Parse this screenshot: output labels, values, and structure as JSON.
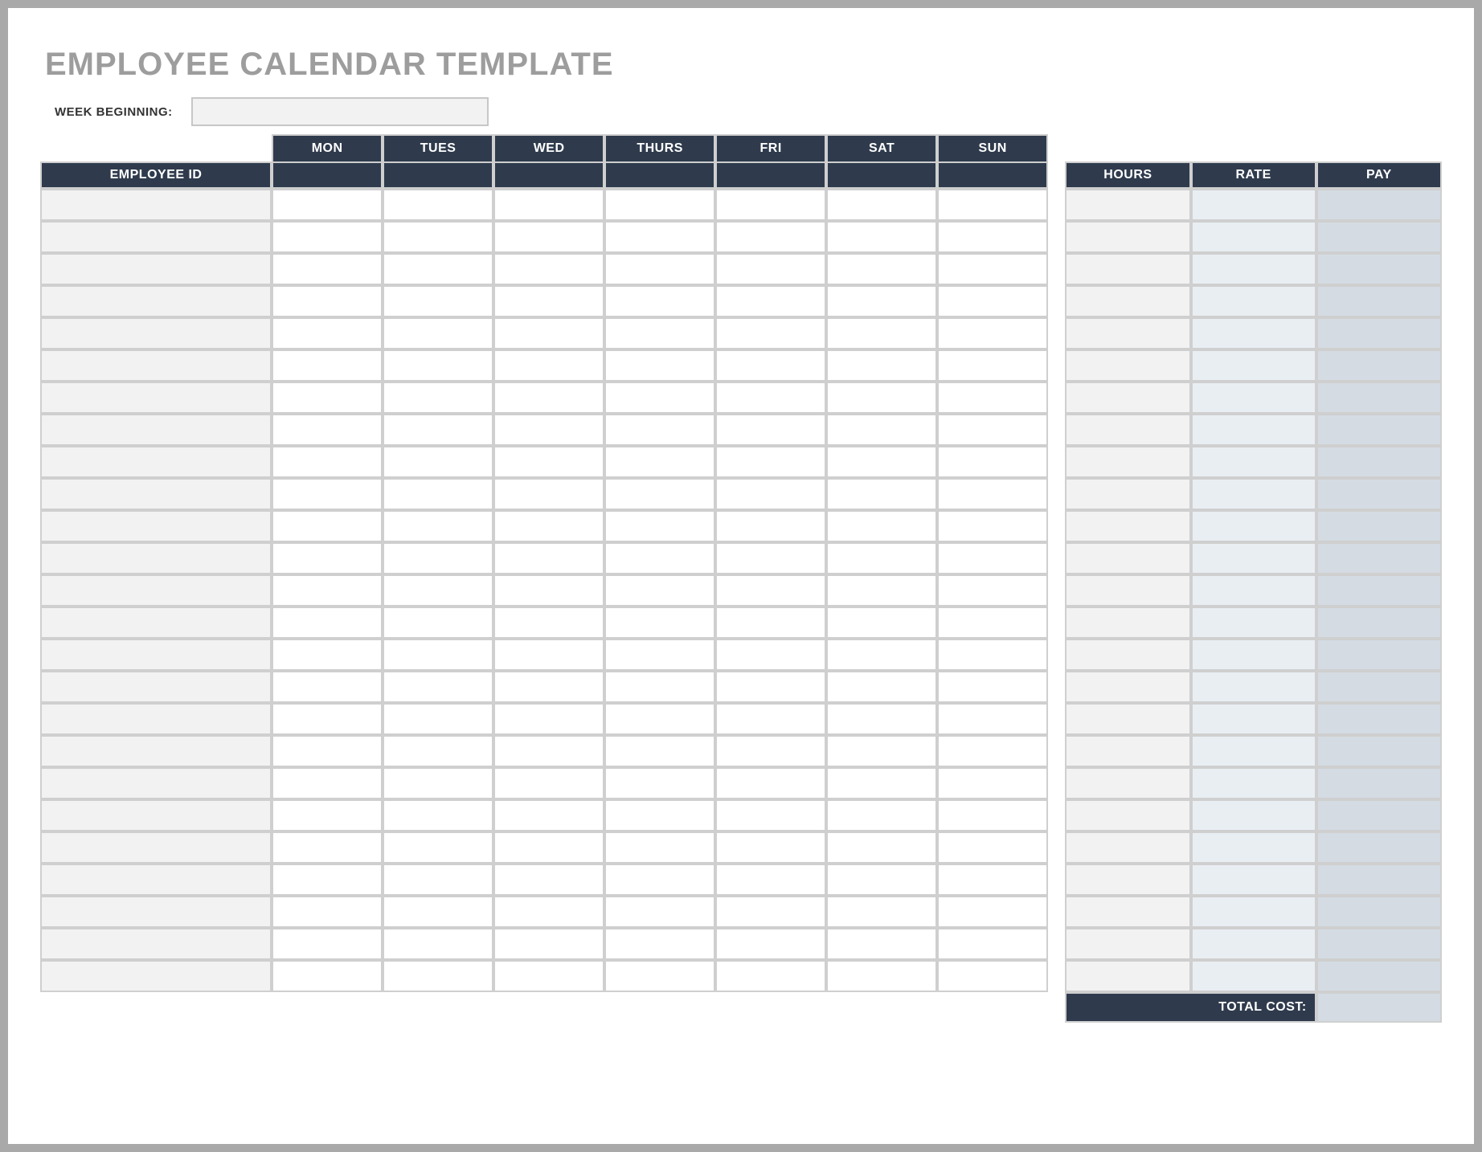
{
  "title": "EMPLOYEE CALENDAR TEMPLATE",
  "week": {
    "label": "WEEK BEGINNING:",
    "value": ""
  },
  "days": [
    "MON",
    "TUES",
    "WED",
    "THURS",
    "FRI",
    "SAT",
    "SUN"
  ],
  "columns": {
    "employee_id": "EMPLOYEE ID",
    "hours": "HOURS",
    "rate": "RATE",
    "pay": "PAY"
  },
  "rows": [
    {
      "employee_id": "",
      "mon": "",
      "tues": "",
      "wed": "",
      "thurs": "",
      "fri": "",
      "sat": "",
      "sun": "",
      "hours": "",
      "rate": "",
      "pay": ""
    },
    {
      "employee_id": "",
      "mon": "",
      "tues": "",
      "wed": "",
      "thurs": "",
      "fri": "",
      "sat": "",
      "sun": "",
      "hours": "",
      "rate": "",
      "pay": ""
    },
    {
      "employee_id": "",
      "mon": "",
      "tues": "",
      "wed": "",
      "thurs": "",
      "fri": "",
      "sat": "",
      "sun": "",
      "hours": "",
      "rate": "",
      "pay": ""
    },
    {
      "employee_id": "",
      "mon": "",
      "tues": "",
      "wed": "",
      "thurs": "",
      "fri": "",
      "sat": "",
      "sun": "",
      "hours": "",
      "rate": "",
      "pay": ""
    },
    {
      "employee_id": "",
      "mon": "",
      "tues": "",
      "wed": "",
      "thurs": "",
      "fri": "",
      "sat": "",
      "sun": "",
      "hours": "",
      "rate": "",
      "pay": ""
    },
    {
      "employee_id": "",
      "mon": "",
      "tues": "",
      "wed": "",
      "thurs": "",
      "fri": "",
      "sat": "",
      "sun": "",
      "hours": "",
      "rate": "",
      "pay": ""
    },
    {
      "employee_id": "",
      "mon": "",
      "tues": "",
      "wed": "",
      "thurs": "",
      "fri": "",
      "sat": "",
      "sun": "",
      "hours": "",
      "rate": "",
      "pay": ""
    },
    {
      "employee_id": "",
      "mon": "",
      "tues": "",
      "wed": "",
      "thurs": "",
      "fri": "",
      "sat": "",
      "sun": "",
      "hours": "",
      "rate": "",
      "pay": ""
    },
    {
      "employee_id": "",
      "mon": "",
      "tues": "",
      "wed": "",
      "thurs": "",
      "fri": "",
      "sat": "",
      "sun": "",
      "hours": "",
      "rate": "",
      "pay": ""
    },
    {
      "employee_id": "",
      "mon": "",
      "tues": "",
      "wed": "",
      "thurs": "",
      "fri": "",
      "sat": "",
      "sun": "",
      "hours": "",
      "rate": "",
      "pay": ""
    },
    {
      "employee_id": "",
      "mon": "",
      "tues": "",
      "wed": "",
      "thurs": "",
      "fri": "",
      "sat": "",
      "sun": "",
      "hours": "",
      "rate": "",
      "pay": ""
    },
    {
      "employee_id": "",
      "mon": "",
      "tues": "",
      "wed": "",
      "thurs": "",
      "fri": "",
      "sat": "",
      "sun": "",
      "hours": "",
      "rate": "",
      "pay": ""
    },
    {
      "employee_id": "",
      "mon": "",
      "tues": "",
      "wed": "",
      "thurs": "",
      "fri": "",
      "sat": "",
      "sun": "",
      "hours": "",
      "rate": "",
      "pay": ""
    },
    {
      "employee_id": "",
      "mon": "",
      "tues": "",
      "wed": "",
      "thurs": "",
      "fri": "",
      "sat": "",
      "sun": "",
      "hours": "",
      "rate": "",
      "pay": ""
    },
    {
      "employee_id": "",
      "mon": "",
      "tues": "",
      "wed": "",
      "thurs": "",
      "fri": "",
      "sat": "",
      "sun": "",
      "hours": "",
      "rate": "",
      "pay": ""
    },
    {
      "employee_id": "",
      "mon": "",
      "tues": "",
      "wed": "",
      "thurs": "",
      "fri": "",
      "sat": "",
      "sun": "",
      "hours": "",
      "rate": "",
      "pay": ""
    },
    {
      "employee_id": "",
      "mon": "",
      "tues": "",
      "wed": "",
      "thurs": "",
      "fri": "",
      "sat": "",
      "sun": "",
      "hours": "",
      "rate": "",
      "pay": ""
    },
    {
      "employee_id": "",
      "mon": "",
      "tues": "",
      "wed": "",
      "thurs": "",
      "fri": "",
      "sat": "",
      "sun": "",
      "hours": "",
      "rate": "",
      "pay": ""
    },
    {
      "employee_id": "",
      "mon": "",
      "tues": "",
      "wed": "",
      "thurs": "",
      "fri": "",
      "sat": "",
      "sun": "",
      "hours": "",
      "rate": "",
      "pay": ""
    },
    {
      "employee_id": "",
      "mon": "",
      "tues": "",
      "wed": "",
      "thurs": "",
      "fri": "",
      "sat": "",
      "sun": "",
      "hours": "",
      "rate": "",
      "pay": ""
    },
    {
      "employee_id": "",
      "mon": "",
      "tues": "",
      "wed": "",
      "thurs": "",
      "fri": "",
      "sat": "",
      "sun": "",
      "hours": "",
      "rate": "",
      "pay": ""
    },
    {
      "employee_id": "",
      "mon": "",
      "tues": "",
      "wed": "",
      "thurs": "",
      "fri": "",
      "sat": "",
      "sun": "",
      "hours": "",
      "rate": "",
      "pay": ""
    },
    {
      "employee_id": "",
      "mon": "",
      "tues": "",
      "wed": "",
      "thurs": "",
      "fri": "",
      "sat": "",
      "sun": "",
      "hours": "",
      "rate": "",
      "pay": ""
    },
    {
      "employee_id": "",
      "mon": "",
      "tues": "",
      "wed": "",
      "thurs": "",
      "fri": "",
      "sat": "",
      "sun": "",
      "hours": "",
      "rate": "",
      "pay": ""
    },
    {
      "employee_id": "",
      "mon": "",
      "tues": "",
      "wed": "",
      "thurs": "",
      "fri": "",
      "sat": "",
      "sun": "",
      "hours": "",
      "rate": "",
      "pay": ""
    }
  ],
  "footer": {
    "total_label": "TOTAL COST:",
    "total_value": ""
  }
}
